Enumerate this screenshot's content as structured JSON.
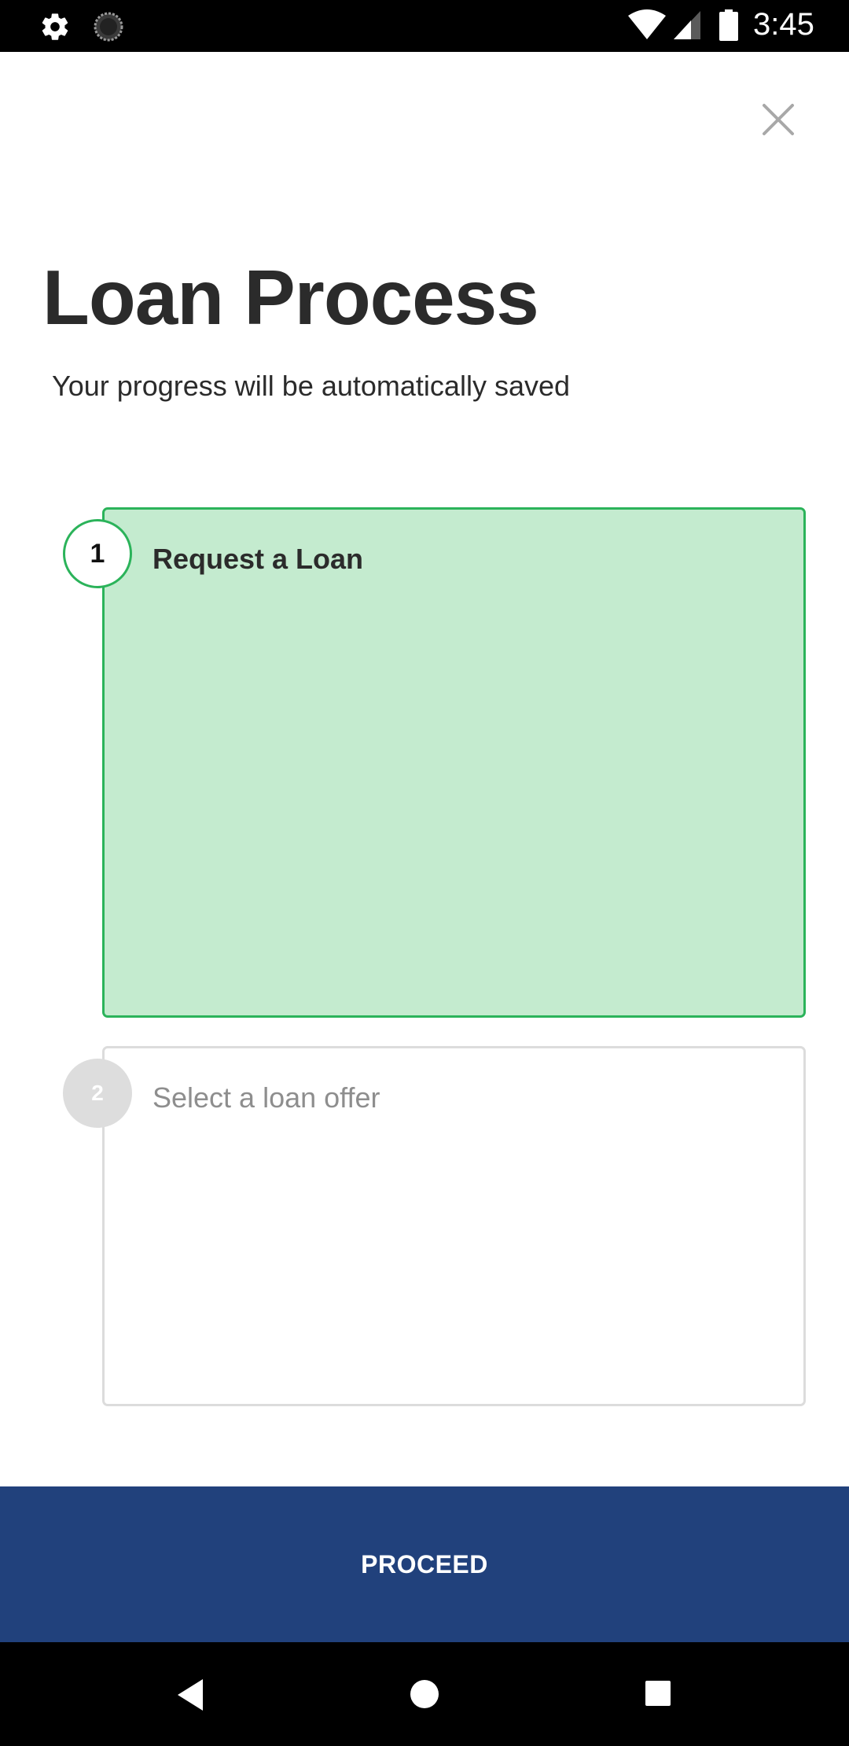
{
  "status_bar": {
    "time": "3:45",
    "icons": [
      "settings-gear-icon",
      "loading-spinner-icon",
      "wifi-icon",
      "cell-signal-icon",
      "battery-icon"
    ]
  },
  "header": {
    "close_icon": "close-icon",
    "title": "Loan Process",
    "subtitle": "Your progress will be automatically saved"
  },
  "steps": [
    {
      "number": "1",
      "label": "Request a Loan",
      "state": "active"
    },
    {
      "number": "2",
      "label": "Select a loan offer",
      "state": "pending"
    }
  ],
  "footer": {
    "proceed_label": "PROCEED"
  },
  "nav_bar": {
    "icons": [
      "back-icon",
      "home-icon",
      "recents-icon"
    ]
  },
  "colors": {
    "accent_green": "#2bb35a",
    "active_card_bg": "#c4ebcf",
    "primary_blue": "#21417c",
    "text_dark": "#2b2b2b",
    "text_muted": "#8e8e8e"
  }
}
